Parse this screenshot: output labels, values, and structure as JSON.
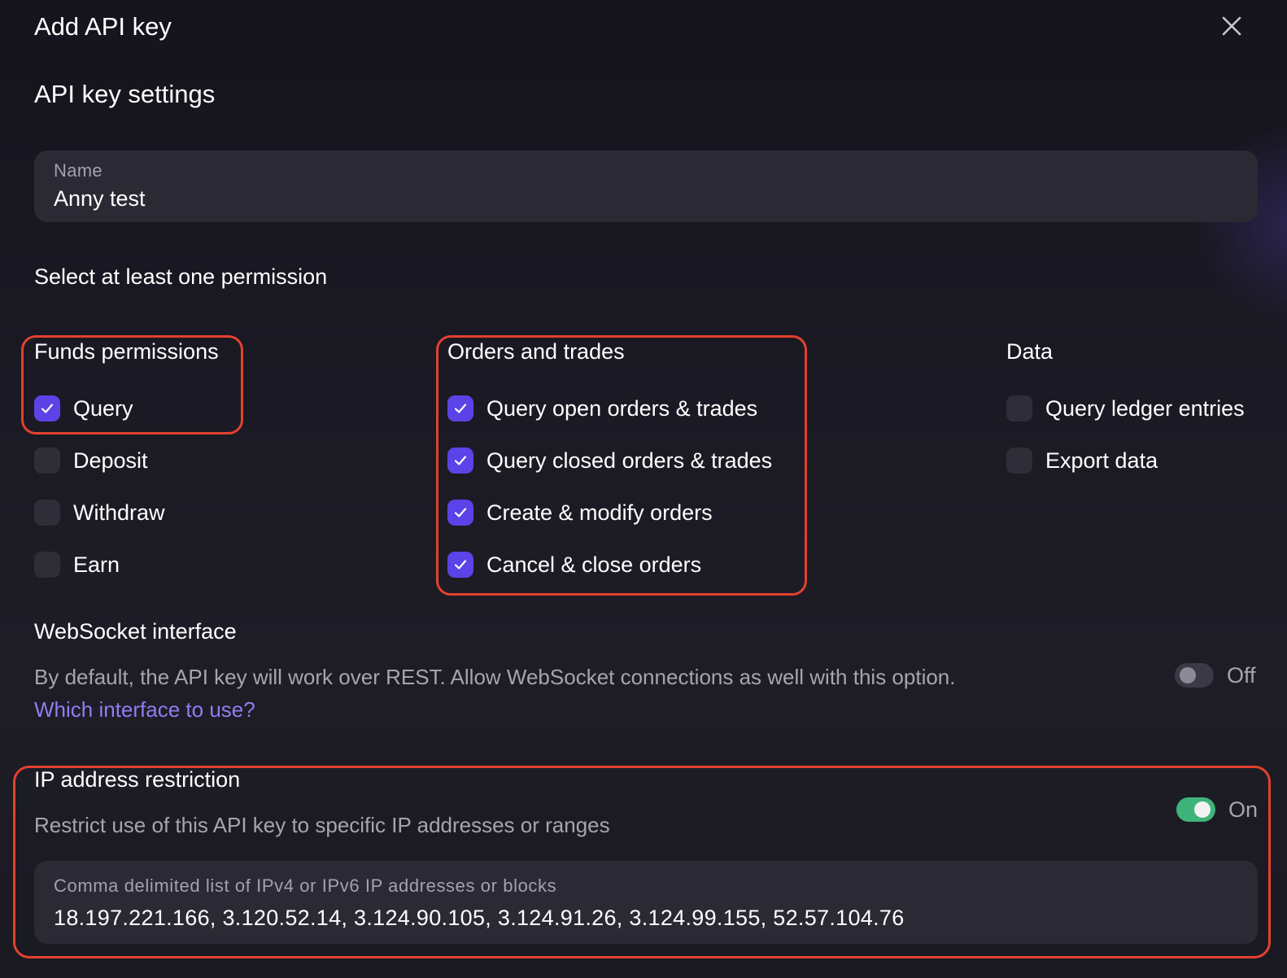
{
  "dialog": {
    "title": "Add API key",
    "close_icon": "close-icon"
  },
  "settings": {
    "title": "API key settings",
    "name_field": {
      "label": "Name",
      "value": "Anny test"
    }
  },
  "permissions": {
    "instruction": "Select at least one permission",
    "funds": {
      "heading": "Funds permissions",
      "items": [
        {
          "label": "Query",
          "checked": true
        },
        {
          "label": "Deposit",
          "checked": false
        },
        {
          "label": "Withdraw",
          "checked": false
        },
        {
          "label": "Earn",
          "checked": false
        }
      ]
    },
    "orders": {
      "heading": "Orders and trades",
      "items": [
        {
          "label": "Query open orders & trades",
          "checked": true
        },
        {
          "label": "Query closed orders & trades",
          "checked": true
        },
        {
          "label": "Create & modify orders",
          "checked": true
        },
        {
          "label": "Cancel & close orders",
          "checked": true
        }
      ]
    },
    "data": {
      "heading": "Data",
      "items": [
        {
          "label": "Query ledger entries",
          "checked": false
        },
        {
          "label": "Export data",
          "checked": false
        }
      ]
    }
  },
  "websocket": {
    "title": "WebSocket interface",
    "description": "By default, the API key will work over REST. Allow WebSocket connections as well with this option.",
    "link": "Which interface to use?",
    "toggle_state": "Off",
    "enabled": false
  },
  "ip_restriction": {
    "title": "IP address restriction",
    "description": "Restrict use of this API key to specific IP addresses or ranges",
    "toggle_state": "On",
    "enabled": true,
    "field_label": "Comma delimited list of IPv4 or IPv6 IP addresses or blocks",
    "field_value": "18.197.221.166, 3.120.52.14, 3.124.90.105, 3.124.91.26, 3.124.99.155, 52.57.104.76"
  },
  "colors": {
    "accent": "#5b43e8",
    "link": "#8e7ef0",
    "toggle_on": "#3fb47a",
    "highlight": "#e2412e"
  }
}
